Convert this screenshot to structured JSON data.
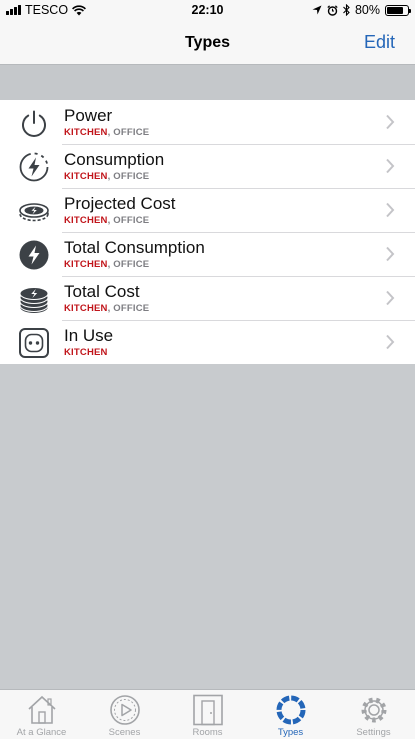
{
  "status_bar": {
    "carrier": "TESCO",
    "time": "22:10",
    "battery": "80%",
    "battery_fraction": 0.8
  },
  "nav": {
    "title": "Types",
    "edit_label": "Edit"
  },
  "rows": [
    {
      "title": "Power",
      "rooms": [
        {
          "text": "KITCHEN",
          "color": "red"
        },
        {
          "text": ",",
          "color": "grey"
        },
        {
          "text": " OFFICE",
          "color": "grey"
        }
      ],
      "icon": "power-icon"
    },
    {
      "title": "Consumption",
      "rooms": [
        {
          "text": "KITCHEN",
          "color": "red"
        },
        {
          "text": ",",
          "color": "grey"
        },
        {
          "text": " OFFICE",
          "color": "grey"
        }
      ],
      "icon": "lightning-dashed-circle-icon"
    },
    {
      "title": "Projected Cost",
      "rooms": [
        {
          "text": "KITCHEN",
          "color": "red"
        },
        {
          "text": ",",
          "color": "grey"
        },
        {
          "text": " OFFICE",
          "color": "grey"
        }
      ],
      "icon": "coin-dashed-icon"
    },
    {
      "title": "Total Consumption",
      "rooms": [
        {
          "text": "KITCHEN",
          "color": "red"
        },
        {
          "text": ",",
          "color": "grey"
        },
        {
          "text": " OFFICE",
          "color": "grey"
        }
      ],
      "icon": "lightning-filled-circle-icon"
    },
    {
      "title": "Total Cost",
      "rooms": [
        {
          "text": "KITCHEN",
          "color": "red"
        },
        {
          "text": ",",
          "color": "grey"
        },
        {
          "text": " OFFICE",
          "color": "grey"
        }
      ],
      "icon": "coin-stack-icon"
    },
    {
      "title": "In Use",
      "rooms": [
        {
          "text": "KITCHEN",
          "color": "red"
        }
      ],
      "icon": "socket-icon"
    }
  ],
  "tabs": [
    {
      "label": "At a Glance",
      "icon": "house-icon",
      "active": false
    },
    {
      "label": "Scenes",
      "icon": "play-circle-icon",
      "active": false
    },
    {
      "label": "Rooms",
      "icon": "door-icon",
      "active": false
    },
    {
      "label": "Types",
      "icon": "ring-icon",
      "active": true
    },
    {
      "label": "Settings",
      "icon": "gear-icon",
      "active": false
    }
  ],
  "colors": {
    "accent": "#2466b8",
    "room_highlight": "#c1151b",
    "room_secondary": "#7d7d82"
  }
}
